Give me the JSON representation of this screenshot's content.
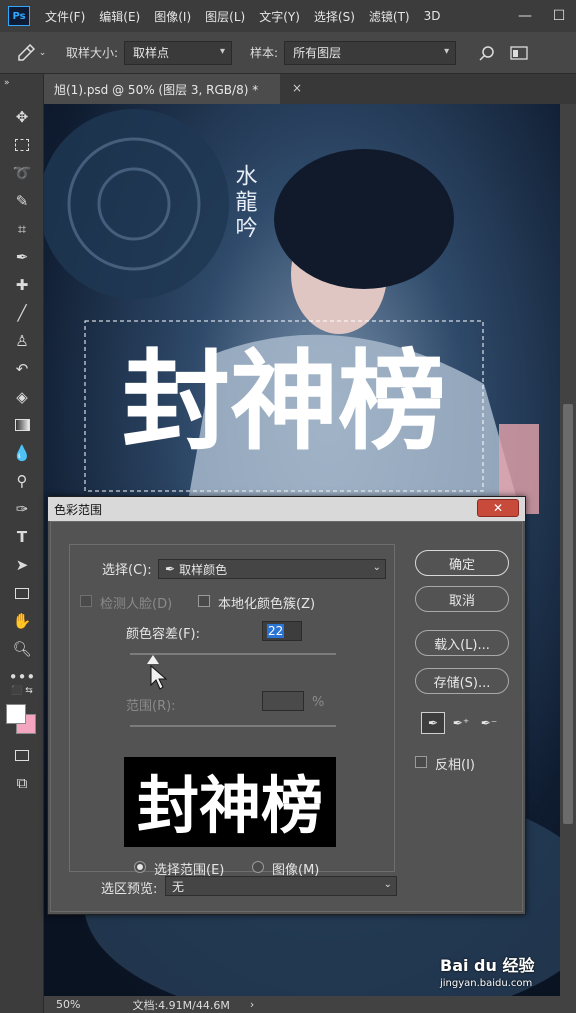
{
  "app": {
    "logo_text": "Ps"
  },
  "menu": [
    "文件(F)",
    "编辑(E)",
    "图像(I)",
    "图层(L)",
    "文字(Y)",
    "选择(S)",
    "滤镜(T)",
    "3D"
  ],
  "window_controls": {
    "minimize": "—",
    "maximize": "☐"
  },
  "options_bar": {
    "sample_size_label": "取样大小:",
    "sample_size_value": "取样点",
    "sample_label": "样本:",
    "sample_value": "所有图层"
  },
  "document_tab": {
    "title": "旭(1).psd @ 50% (图层 3, RGB/8) *",
    "close": "×"
  },
  "status_bar": {
    "zoom": "50%",
    "doc_info": "文档:4.91M/44.6M",
    "arrow": "›"
  },
  "dialog": {
    "title": "色彩范围",
    "close": "✕",
    "select_label": "选择(C):",
    "select_value": "取样颜色",
    "detect_faces": "检测人脸(D)",
    "localized_clusters": "本地化颜色簇(Z)",
    "fuzziness_label": "颜色容差(F):",
    "fuzziness_value": "22",
    "fuzziness_fraction": 0.11,
    "range_label": "范围(R):",
    "range_unit": "%",
    "preview_text": "封神榜",
    "radio_selection": "选择范围(E)",
    "radio_image": "图像(M)",
    "preview_mode_label": "选区预览:",
    "preview_mode_value": "无",
    "buttons": {
      "ok": "确定",
      "cancel": "取消",
      "load": "载入(L)...",
      "save": "存储(S)..."
    },
    "invert_label": "反相(I)"
  },
  "canvas": {
    "title_text": "封神榜",
    "side_text": "水龍吟"
  },
  "watermark": {
    "brand": "Bai du 经验",
    "url": "jingyan.baidu.com"
  },
  "colors": {
    "accent": "#31a8ff",
    "close_red": "#c74a3b",
    "background_swatch": "#f4a6c0"
  }
}
